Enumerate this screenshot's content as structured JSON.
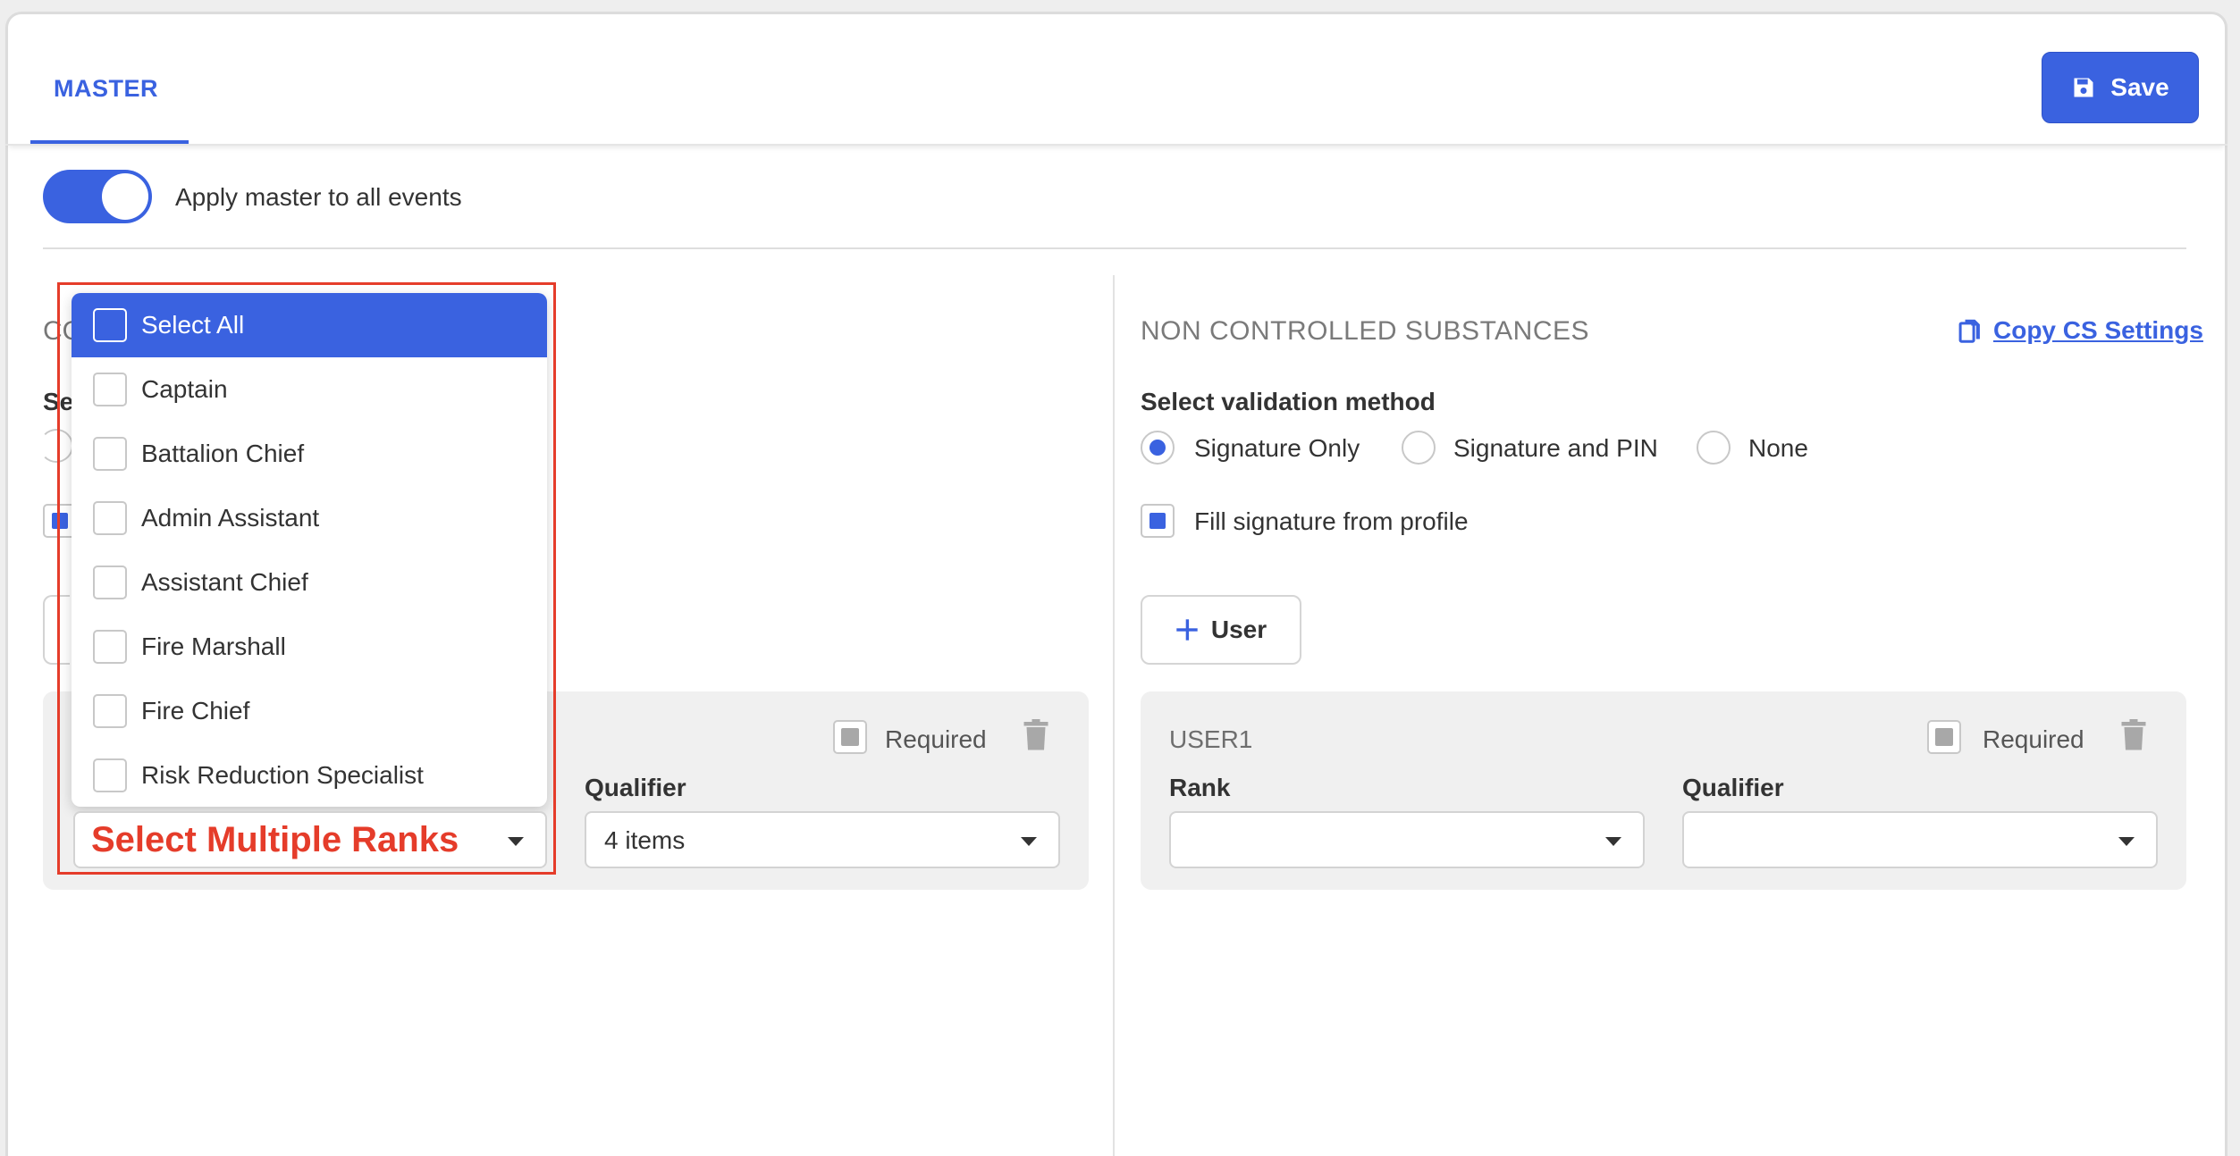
{
  "tabs": [
    {
      "label": "MASTER",
      "active": true
    }
  ],
  "toolbar": {
    "save_label": "Save"
  },
  "master_toggle": {
    "label": "Apply master to all events",
    "on": true
  },
  "left_panel": {
    "title_fragment": "CO",
    "validation_fragment": "Se",
    "user_card": {
      "required_label": "Required",
      "qualifier_label": "Qualifier",
      "qualifier_value": "4 items"
    }
  },
  "right_panel": {
    "title": "NON CONTROLLED SUBSTANCES",
    "copy_link": "Copy CS Settings",
    "validation_label": "Select validation method",
    "validation_options": [
      {
        "label": "Signature Only",
        "selected": true
      },
      {
        "label": "Signature and PIN",
        "selected": false
      },
      {
        "label": "None",
        "selected": false
      }
    ],
    "fill_signature": {
      "label": "Fill signature from profile",
      "checked": true
    },
    "add_user_label": "User",
    "user_card": {
      "title": "USER1",
      "required_label": "Required",
      "rank_label": "Rank",
      "qualifier_label": "Qualifier",
      "rank_value": "",
      "qualifier_value": ""
    }
  },
  "rank_dropdown": {
    "items": [
      {
        "label": "Select All",
        "active": true
      },
      {
        "label": "Captain",
        "active": false
      },
      {
        "label": "Battalion Chief",
        "active": false
      },
      {
        "label": "Admin Assistant",
        "active": false
      },
      {
        "label": "Assistant Chief",
        "active": false
      },
      {
        "label": "Fire Marshall",
        "active": false
      },
      {
        "label": "Fire Chief",
        "active": false
      },
      {
        "label": "Risk Reduction Specialist",
        "active": false
      }
    ]
  },
  "annotation": {
    "text": "Select Multiple Ranks",
    "color": "#e53c2a"
  },
  "colors": {
    "accent": "#3a62e0",
    "annotation": "#e53c2a"
  },
  "icons": {
    "save": "floppy-disk-icon",
    "copy": "copy-icon",
    "plus": "plus-icon",
    "trash": "trash-icon",
    "caret": "caret-down-icon"
  }
}
